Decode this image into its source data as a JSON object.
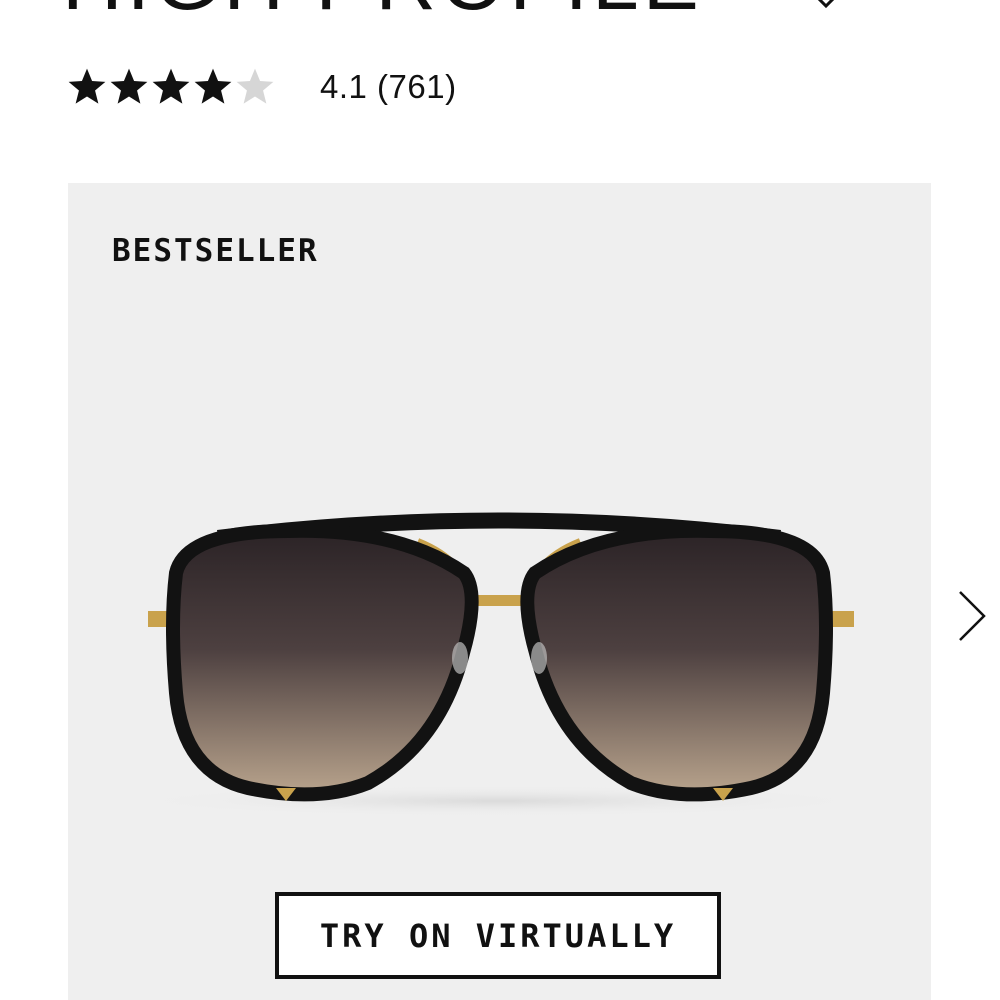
{
  "product": {
    "title": "HIGH PROFILE",
    "rating_value": 4.1,
    "rating_text": "4.1 (761)",
    "star_count": 5,
    "stars_filled": 4
  },
  "gallery": {
    "badge": "BESTSELLER",
    "image_alt": "Black aviator sunglasses with gold bridge and gradient lenses",
    "try_on_label": "TRY ON VIRTUALLY",
    "next_icon": "chevron-right-icon"
  },
  "colors": {
    "text": "#111111",
    "gallery_background": "#efefef",
    "star_filled": "#111111",
    "star_empty": "#d6d6d6",
    "frame": "#121212",
    "metal": "#c9a24c"
  }
}
